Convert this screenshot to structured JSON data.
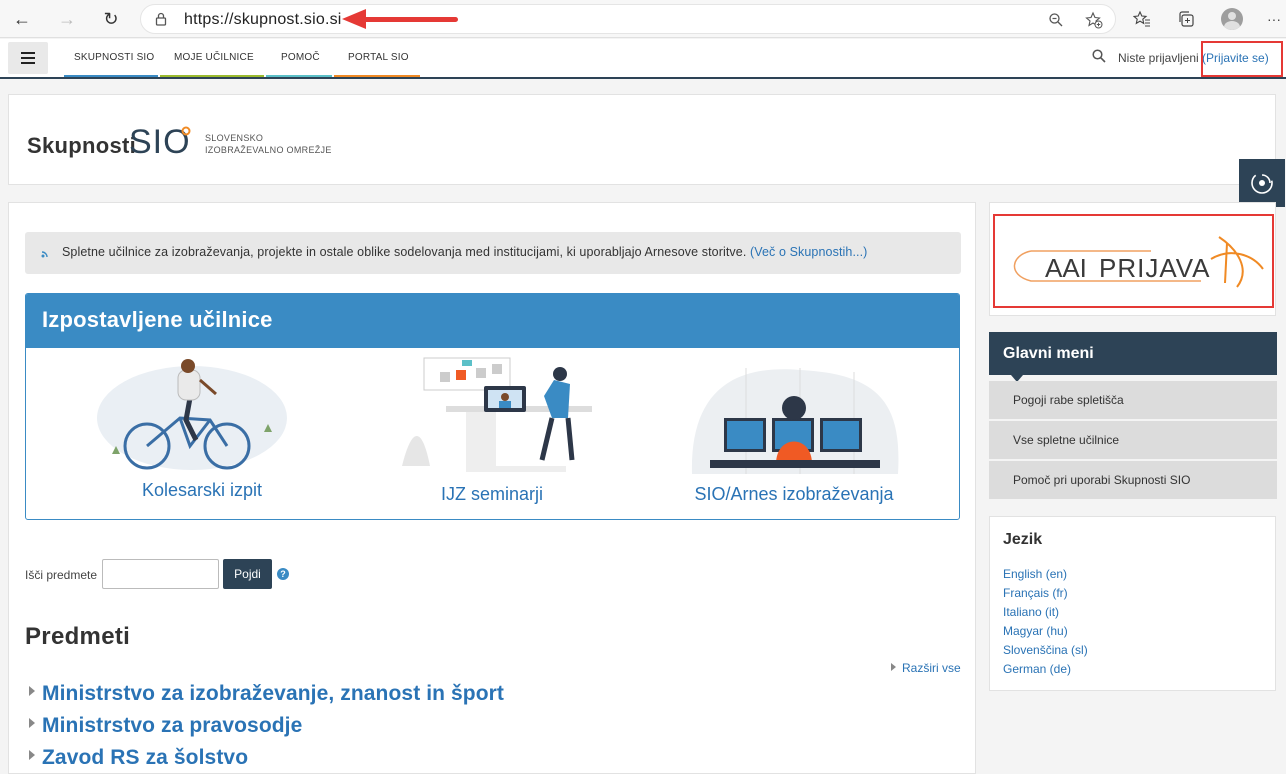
{
  "browser": {
    "url": "https://skupnost.sio.si"
  },
  "navbar": {
    "items": [
      {
        "label": "SKUPNOSTI SIO",
        "color": "#3a8bc4"
      },
      {
        "label": "MOJE UČILNICE",
        "color": "#9bbb2e"
      },
      {
        "label": "POMOČ",
        "color": "#5bc0c8"
      },
      {
        "label": "PORTAL SIO",
        "color": "#f08a24"
      }
    ],
    "login_prefix": "Niste prijavljeni",
    "login_link": "(Prijavite se)"
  },
  "header": {
    "logo_word": "Skupnosti",
    "logo_sio": "SIO",
    "logo_sub1": "SLOVENSKO",
    "logo_sub2": "IZOBRAŽEVALNO OMREŽJE"
  },
  "notice": {
    "text": "Spletne učilnice za izobraževanja, projekte in ostale oblike sodelovanja med institucijami, ki uporabljajo Arnesove storitve.",
    "link": "(Več o Skupnostih...)"
  },
  "featured": {
    "title": "Izpostavljene učilnice",
    "items": [
      {
        "caption": "Kolesarski izpit"
      },
      {
        "caption": "IJZ seminarji"
      },
      {
        "caption": "SIO/Arnes izobraževanja"
      }
    ]
  },
  "search": {
    "label": "Išči predmete",
    "value": "",
    "button": "Pojdi"
  },
  "courses": {
    "title": "Predmeti",
    "expand": "Razširi vse",
    "categories": [
      "Ministrstvo za izobraževanje, znanost in šport",
      "Ministrstvo za pravosodje",
      "Zavod RS za šolstvo"
    ]
  },
  "aai": {
    "brand_a": "AAI",
    "brand_b": "PRIJAVA"
  },
  "main_menu": {
    "title": "Glavni meni",
    "items": [
      "Pogoji rabe spletišča",
      "Vse spletne učilnice",
      "Pomoč pri uporabi Skupnosti SIO"
    ]
  },
  "languages": {
    "title": "Jezik",
    "items": [
      "English (en)",
      "Français (fr)",
      "Italiano (it)",
      "Magyar (hu)",
      "Slovenščina (sl)",
      "German (de)"
    ]
  },
  "colors": {
    "navy": "#2d4356",
    "blue": "#3a8bc4",
    "link": "#2a73b5",
    "annotation_red": "#e53935"
  }
}
